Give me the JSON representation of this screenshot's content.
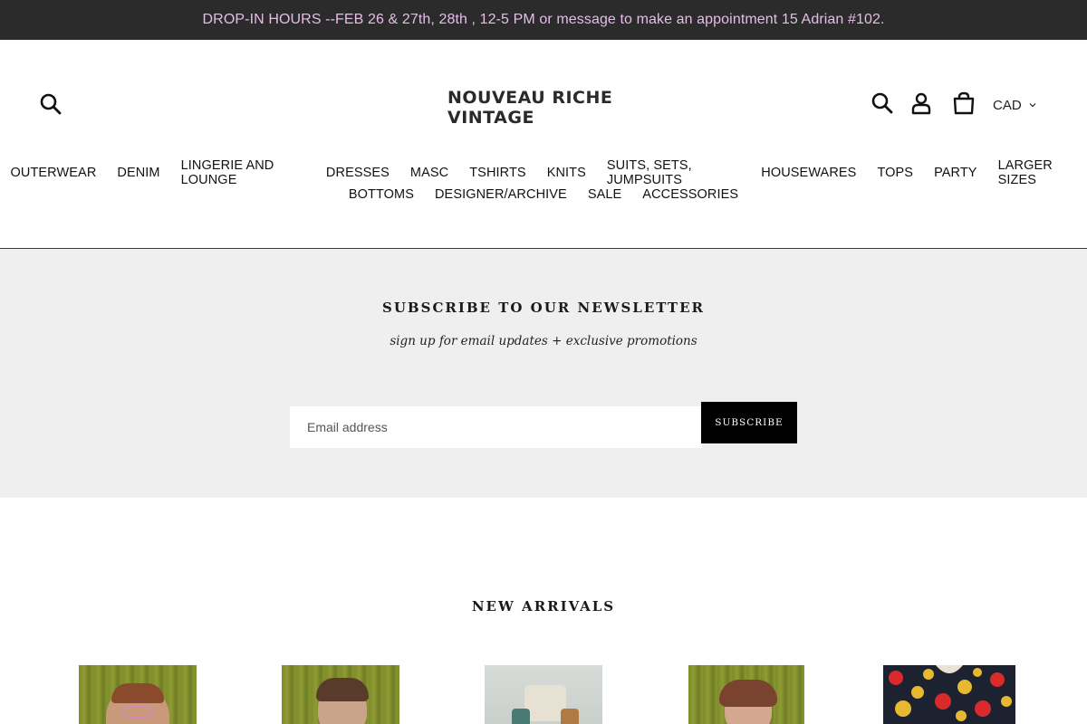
{
  "announcement": {
    "text": "DROP-IN HOURS --FEB 26 & 27th, 28th , 12-5 PM or message to make an appointment 15 Adrian #102."
  },
  "header": {
    "logo": {
      "line1": "NOUVEAU RICHE",
      "line2": "VINTAGE"
    },
    "currency": "CAD",
    "icons": [
      "search-icon",
      "account-icon",
      "cart-icon",
      "chevron-down-icon"
    ]
  },
  "nav": {
    "row1": [
      "OUTERWEAR",
      "DENIM",
      "LINGERIE AND LOUNGE",
      "DRESSES",
      "MASC",
      "TSHIRTS",
      "KNITS",
      "SUITS, SETS, JUMPSUITS",
      "HOUSEWARES",
      "TOPS",
      "PARTY",
      "LARGER SIZES"
    ],
    "row2": [
      "BOTTOMS",
      "DESIGNER/ARCHIVE",
      "SALE",
      "ACCESSORIES"
    ]
  },
  "newsletter": {
    "title": "SUBSCRIBE TO OUR NEWSLETTER",
    "subtitle": "sign up for email updates + exclusive promotions",
    "email_placeholder": "Email address",
    "button_label": "SUBSCRIBE"
  },
  "arrivals": {
    "title": "NEW ARRIVALS"
  },
  "colors": {
    "announcement_bg": "#2b2b2b",
    "announcement_text": "#e6bde8",
    "newsletter_bg": "#efefef",
    "button_bg": "#000000"
  }
}
